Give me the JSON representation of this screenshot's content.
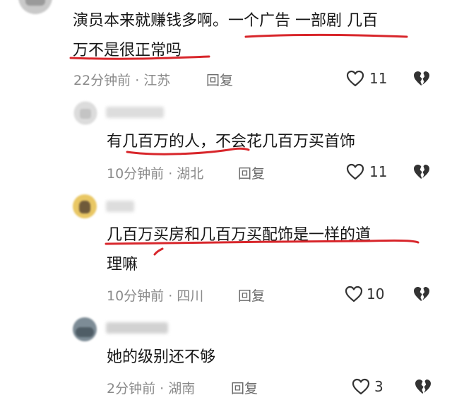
{
  "comments": [
    {
      "text_lines": [
        "演员本来就赚钱多啊。一个广告 一部剧  几百",
        "万不是很正常吗"
      ],
      "meta": "22分钟前 · 江苏",
      "reply_label": "回复",
      "likes": "11"
    },
    {
      "text_lines": [
        "有几百万的人，不会花几百万买首饰"
      ],
      "meta": "10分钟前 · 湖北",
      "reply_label": "回复",
      "likes": "11"
    },
    {
      "text_lines": [
        "几百万买房和几百万买配饰是一样的道",
        "理嘛"
      ],
      "meta": "10分钟前 · 四川",
      "reply_label": "回复",
      "likes": "10"
    },
    {
      "text_lines": [
        "她的级别还不够"
      ],
      "meta": "2分钟前 · 湖南",
      "reply_label": "回复",
      "likes": "3"
    }
  ],
  "icons": {
    "like": "heart-outline-icon",
    "dislike": "broken-heart-icon"
  },
  "colors": {
    "annotation_red": "#d8262b",
    "meta_gray": "#8a8a8a",
    "text": "#161616"
  }
}
